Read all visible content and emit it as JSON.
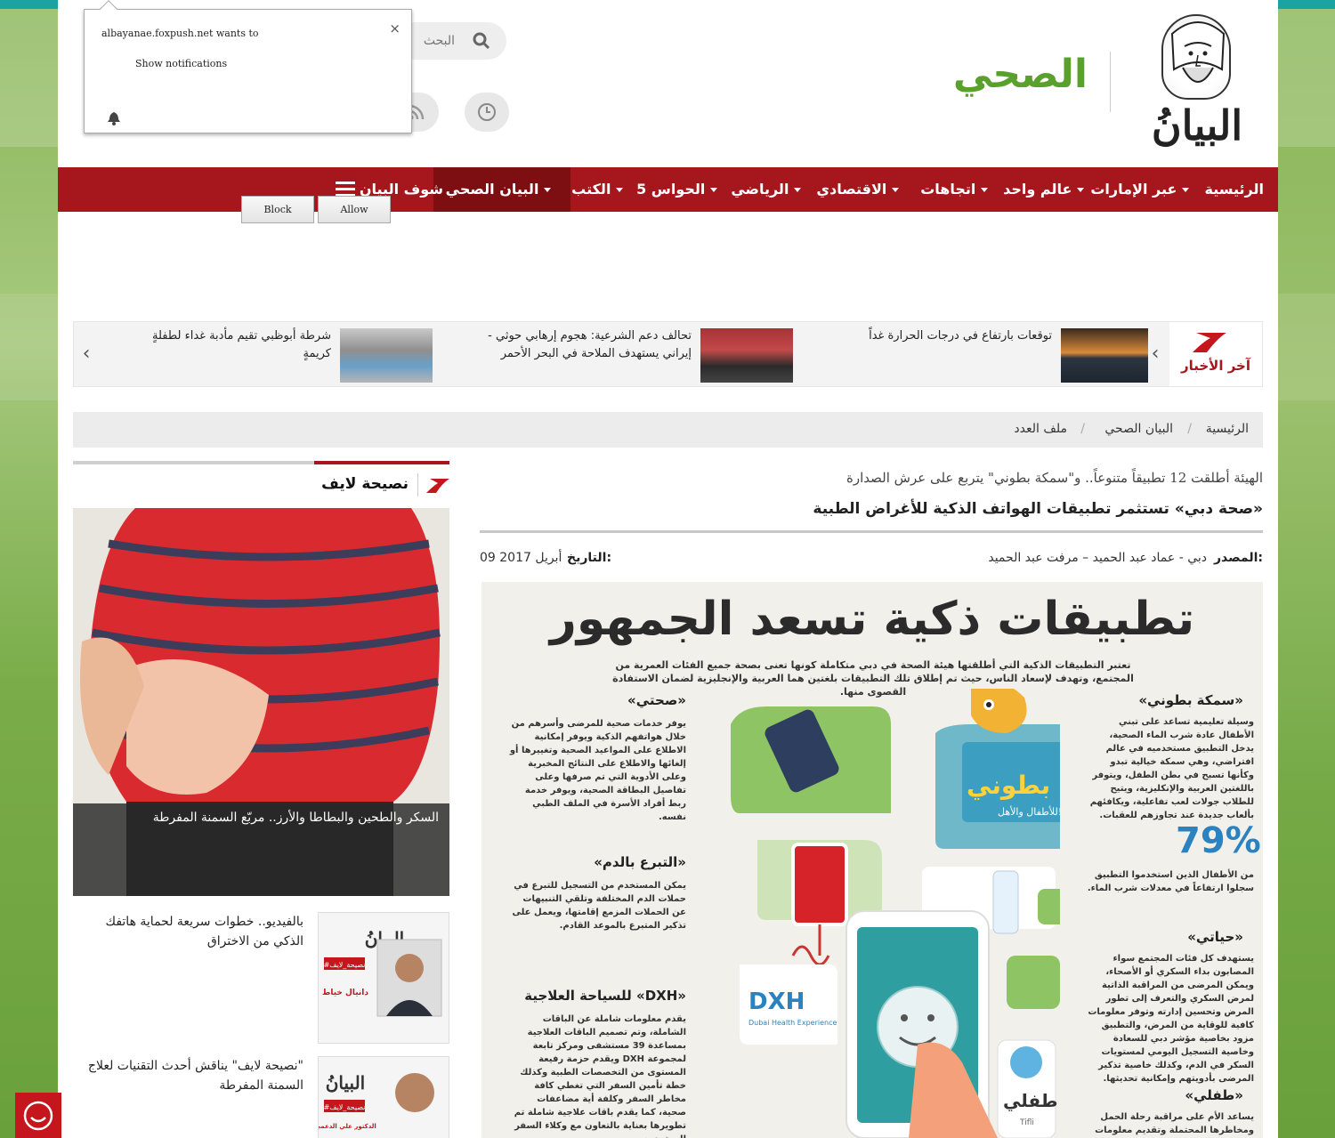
{
  "header": {
    "logo_text": "البيانُ",
    "section_title": "الصحي",
    "search": {
      "placeholder": "البحث"
    }
  },
  "nav": {
    "items": [
      {
        "label": "الرئيسية"
      },
      {
        "label": "عبر الإمارات"
      },
      {
        "label": "عالم واحد"
      },
      {
        "label": "اتجاهات"
      },
      {
        "label": "الاقتصادي"
      },
      {
        "label": "الرياضي"
      },
      {
        "label": "5 الحواس"
      },
      {
        "label": "الكتب"
      },
      {
        "label": "البيان الصحي"
      },
      {
        "label": "شوف البيان"
      }
    ],
    "active": "البيان الصحي"
  },
  "ticker": {
    "label": "آخر الأخبار",
    "items": [
      {
        "text": "توقعات بارتفاع في درجات الحرارة غداً"
      },
      {
        "text": "تحالف دعم الشرعية: هجوم إرهابي حوثي - إيراني يستهدف الملاحة في البحر الأحمر"
      },
      {
        "text": "شرطة أبوظبي تقيم مأدبة غداء لطفلةٍ كريمةٍ"
      }
    ]
  },
  "breadcrumb": {
    "items": [
      "الرئيسية",
      "البيان الصحي",
      "ملف العدد"
    ],
    "separator": "/"
  },
  "article": {
    "kicker": "الهيئة أطلقت 12 تطبيقاً متنوعاً.. و\"سمكة بطوني\" يتربع على عرش الصدارة",
    "headline": "«صحة دبي» تستثمر تطبيقات الهواتف الذكية للأغراض الطبية",
    "source_label": "المصدر:",
    "source_value": "دبي - عماد عبد الحميد – مرفت عبد الحميد",
    "date_label": "التاريخ:",
    "date_value": "09 أبريل 2017"
  },
  "infographic": {
    "title": "تطبيقات ذكية تسعد الجمهور",
    "intro": "تعتبر التطبيقات الذكية التي أطلقتها هيئة الصحة في دبي متكاملة كونها تعنى بصحة جميع الفئات العمرية من المجتمع، وتهدف لإسعاد الناس، حيث تم إطلاق تلك التطبيقات بلغتين هما العربية والإنجليزية لضمان الاستفادة القصوى منها.",
    "sections": [
      {
        "head": "«سمكة بطوني»",
        "body": "وسيلة تعليمية تساعد على تبني الأطفال عادة شرب الماء الصحية، يدخل التطبيق مستخدميه في عالم افتراضي، وهي سمكة خيالية تبدو وكأنها تسبح في بطن الطفل، ويتوفر باللغتين العربية والإنكليزية، ويتيح للطلاب جولات لعب تفاعلية، ويكافئهم بألعاب جديدة عند تجاوزهم للعقبات."
      },
      {
        "head": "«صحتي»",
        "body": "يوفر خدمات صحية للمرضى وأسرهم من خلال هواتفهم الذكية ويوفر إمكانية الاطلاع على المواعيد الصحية وتغييرها أو إلغائها والاطلاع على النتائج المخبرية وعلى الأدوية التي تم صرفها وعلى تفاصيل البطاقة الصحية، ويوفر خدمة ربط أفراد الأسرة في الملف الطبي نفسه."
      },
      {
        "head": "«التبرع بالدم»",
        "body": "يمكن المستخدم من التسجيل للتبرع في حملات الدم المختلفة وتلقي التنبيهات عن الحملات المزمع إقامتها، ويعمل على تذكير المتبرع بالموعد القادم."
      },
      {
        "head": "«حياتي»",
        "body": "يستهدف كل فئات المجتمع سواء المصابون بداء السكري أو الأصحاء، ويمكن المرضى من المراقبة الذاتية لمرض السكري والتعرف إلى تطور المرض وتحسين إدارته وتوفر معلومات كافية للوقاية من المرض، والتطبيق مزود بخاصية مؤشر دبي للسعادة وخاصية التسجيل اليومي لمستويات السكر في الدم، وكذلك خاصية تذكير المرضى بأدويتهم وإمكانية تحديثها."
      },
      {
        "head": "«DXH» للسياحة العلاجية",
        "body": "يقدم معلومات شاملة عن الباقات الشاملة، وتم تصميم الباقات العلاجية بمساعدة 39 مستشفى ومركز تابعة لمجموعة DXH ويقدم حزمة رفيعة المستوى من التخصصات الطبية وكذلك خطة تأمين السفر التي تغطي كافة مخاطر السفر وكلفة أية مضاعفات صحية، كما يقدم باقات علاجية شاملة تم تطويرها بعناية بالتعاون مع وكلاء السفر المعتمدين."
      },
      {
        "head": "«طفلي»",
        "body": "يساعد الأم على مراقبة رحلة الحمل ومخاطرها المحتملة وتقديم معلومات متخصصة عن الحمل"
      }
    ],
    "stat_value": "79%",
    "stat_caption": "من الأطفال الذين استخدموا التطبيق سجلوا ارتفاعاً في معدلات شرب الماء.",
    "app_labels": {
      "fish": "سمكة بطوني",
      "fish_sub": "للأطفال والأهل!",
      "dxh": "DXH",
      "dxh_sub": "Dubai Health Experience",
      "tifli": "طفلي",
      "tifli_en": "Tifli"
    }
  },
  "sidebar": {
    "title": "نصيحة لايف",
    "feature_caption": "السكر والطحين والبطاطا والأرز.. مربّع السمنة المفرطة",
    "items": [
      {
        "text": "بالفيديو.. خطوات سريعة لحماية هاتفك الذكي من الاختراق",
        "thumb_tag": "#نصيحة_لايف",
        "thumb_name": "دانيال خياط"
      },
      {
        "text": "\"نصيحة لايف\" يناقش أحدث التقنيات لعلاج السمنة المفرطة",
        "thumb_tag": "#نصيحة_لايف",
        "thumb_name": "الدكتور علي الدعمي"
      }
    ]
  },
  "notification": {
    "host_text": "albayanae.foxpush.net wants to",
    "subtext": "Show notifications",
    "block_label": "Block",
    "allow_label": "Allow",
    "close_glyph": "×"
  },
  "colors": {
    "brand_red": "#a5171c",
    "section_green": "#5aa02c",
    "stat_blue": "#2a82c0"
  }
}
